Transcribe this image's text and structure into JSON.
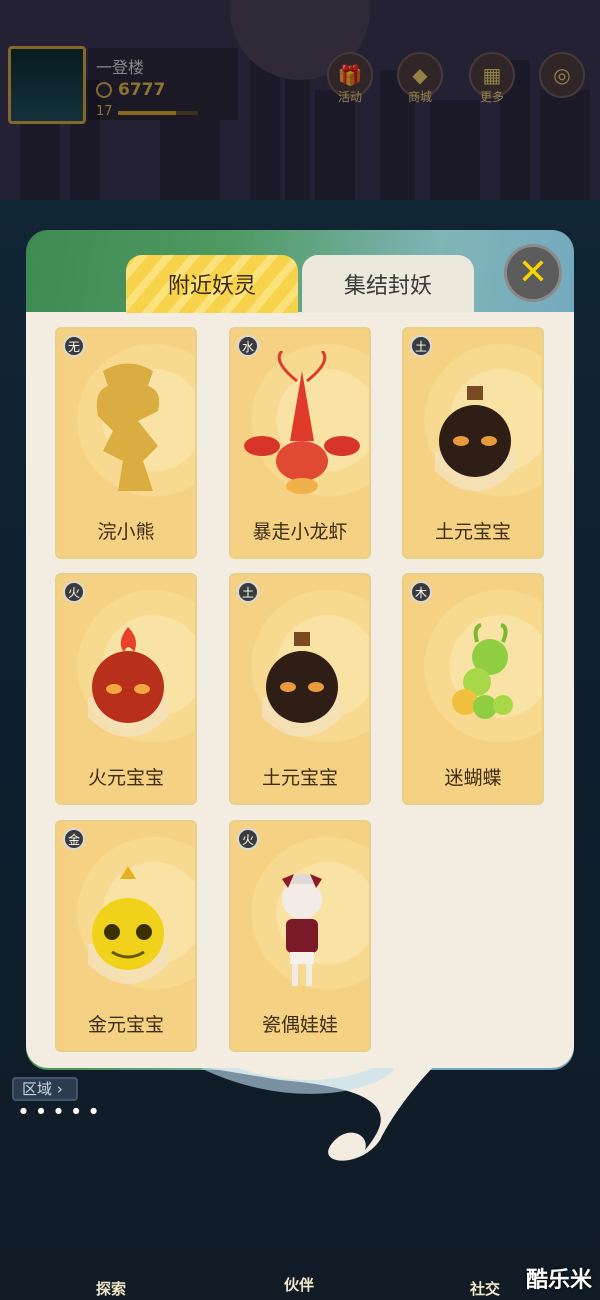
{
  "hud": {
    "player_name": "一登楼",
    "coins": "6777",
    "level": "17",
    "level_progress": 0.72
  },
  "top_buttons": [
    {
      "label": "活动",
      "icon": "gift-icon"
    },
    {
      "label": "商城",
      "icon": "shop-icon"
    },
    {
      "label": "更多",
      "icon": "more-grid-icon"
    },
    {
      "label": "",
      "icon": "radar-icon"
    }
  ],
  "dialog": {
    "tabs": [
      "附近妖灵",
      "集结封妖"
    ],
    "active_tab": 0,
    "close_icon": "close-x-icon",
    "cards": [
      {
        "element": "无",
        "name": "浣小熊",
        "icon": "raccoon-silhouette-icon"
      },
      {
        "element": "水",
        "name": "暴走小龙虾",
        "icon": "crayfish-icon"
      },
      {
        "element": "土",
        "name": "土元宝宝",
        "icon": "earth-spirit-icon"
      },
      {
        "element": "火",
        "name": "火元宝宝",
        "icon": "fire-spirit-icon"
      },
      {
        "element": "土",
        "name": "土元宝宝",
        "icon": "earth-spirit-icon"
      },
      {
        "element": "木",
        "name": "迷蝴蝶",
        "icon": "caterpillar-icon"
      },
      {
        "element": "金",
        "name": "金元宝宝",
        "icon": "gold-spirit-icon"
      },
      {
        "element": "火",
        "name": "瓷偶娃娃",
        "icon": "porcelain-doll-icon"
      }
    ]
  },
  "bottom": {
    "area_label": "区域",
    "nav": [
      "探索",
      "伙伴",
      "社交"
    ]
  },
  "watermark": "酷乐米",
  "colors": {
    "accent_gold": "#f6d34a",
    "card_bg": "#f5d283",
    "frame_green": "#4f9a63"
  }
}
